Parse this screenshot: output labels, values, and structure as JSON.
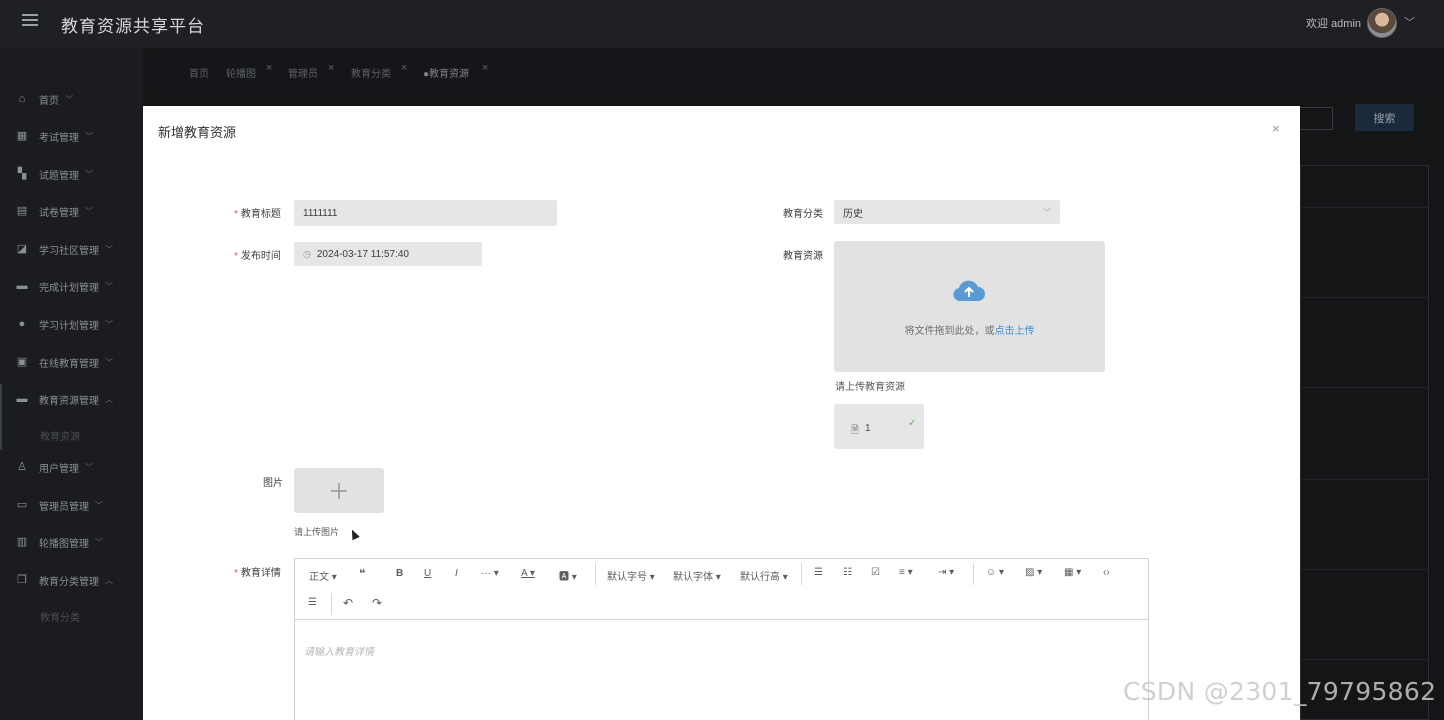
{
  "header": {
    "app_title": "教育资源共享平台",
    "welcome_text": "欢迎 admin"
  },
  "sidebar": {
    "items": [
      {
        "label": "首页",
        "icon": "home-icon"
      },
      {
        "label": "考试管理",
        "icon": "grid-icon"
      },
      {
        "label": "试题管理",
        "icon": "dashboard-icon"
      },
      {
        "label": "试卷管理",
        "icon": "document-icon"
      },
      {
        "label": "学习社区管理",
        "icon": "chart-icon"
      },
      {
        "label": "完成计划管理",
        "icon": "book-icon"
      },
      {
        "label": "学习计划管理",
        "icon": "check-circle-icon"
      },
      {
        "label": "在线教育管理",
        "icon": "gift-icon"
      },
      {
        "label": "教育资源管理",
        "icon": "wallet-icon"
      },
      {
        "label": "用户管理",
        "icon": "user-icon"
      },
      {
        "label": "管理员管理",
        "icon": "card-icon"
      },
      {
        "label": "轮播图管理",
        "icon": "briefcase-icon"
      },
      {
        "label": "教育分类管理",
        "icon": "copy-icon"
      }
    ],
    "sub_items": [
      "教育资源",
      "教育分类"
    ]
  },
  "tabs": [
    {
      "label": "首页",
      "closable": false
    },
    {
      "label": "轮播图",
      "closable": true
    },
    {
      "label": "管理员",
      "closable": true
    },
    {
      "label": "教育分类",
      "closable": true
    },
    {
      "label": "●教育资源",
      "closable": true
    }
  ],
  "background": {
    "search_button": "搜索"
  },
  "dialog": {
    "title": "新增教育资源",
    "close": "×",
    "fields": {
      "title_label": "教育标题",
      "title_value": "1111111",
      "time_label": "发布时间",
      "time_value": "2024-03-17 11:57:40",
      "category_label": "教育分类",
      "category_value": "历史",
      "resource_label": "教育资源",
      "upload_text": "将文件拖到此处，或",
      "upload_link": "点击上传",
      "upload_tip": "请上传教育资源",
      "file_name": "1",
      "picture_label": "图片",
      "picture_tip": "请上传图片",
      "detail_label": "教育详情"
    },
    "editor": {
      "paragraph": "正文",
      "font_size": "默认字号",
      "font_family": "默认字体",
      "line_height": "默认行高",
      "more": "···",
      "placeholder": "请输入教育详情"
    }
  },
  "watermark": "CSDN @2301_79795862"
}
